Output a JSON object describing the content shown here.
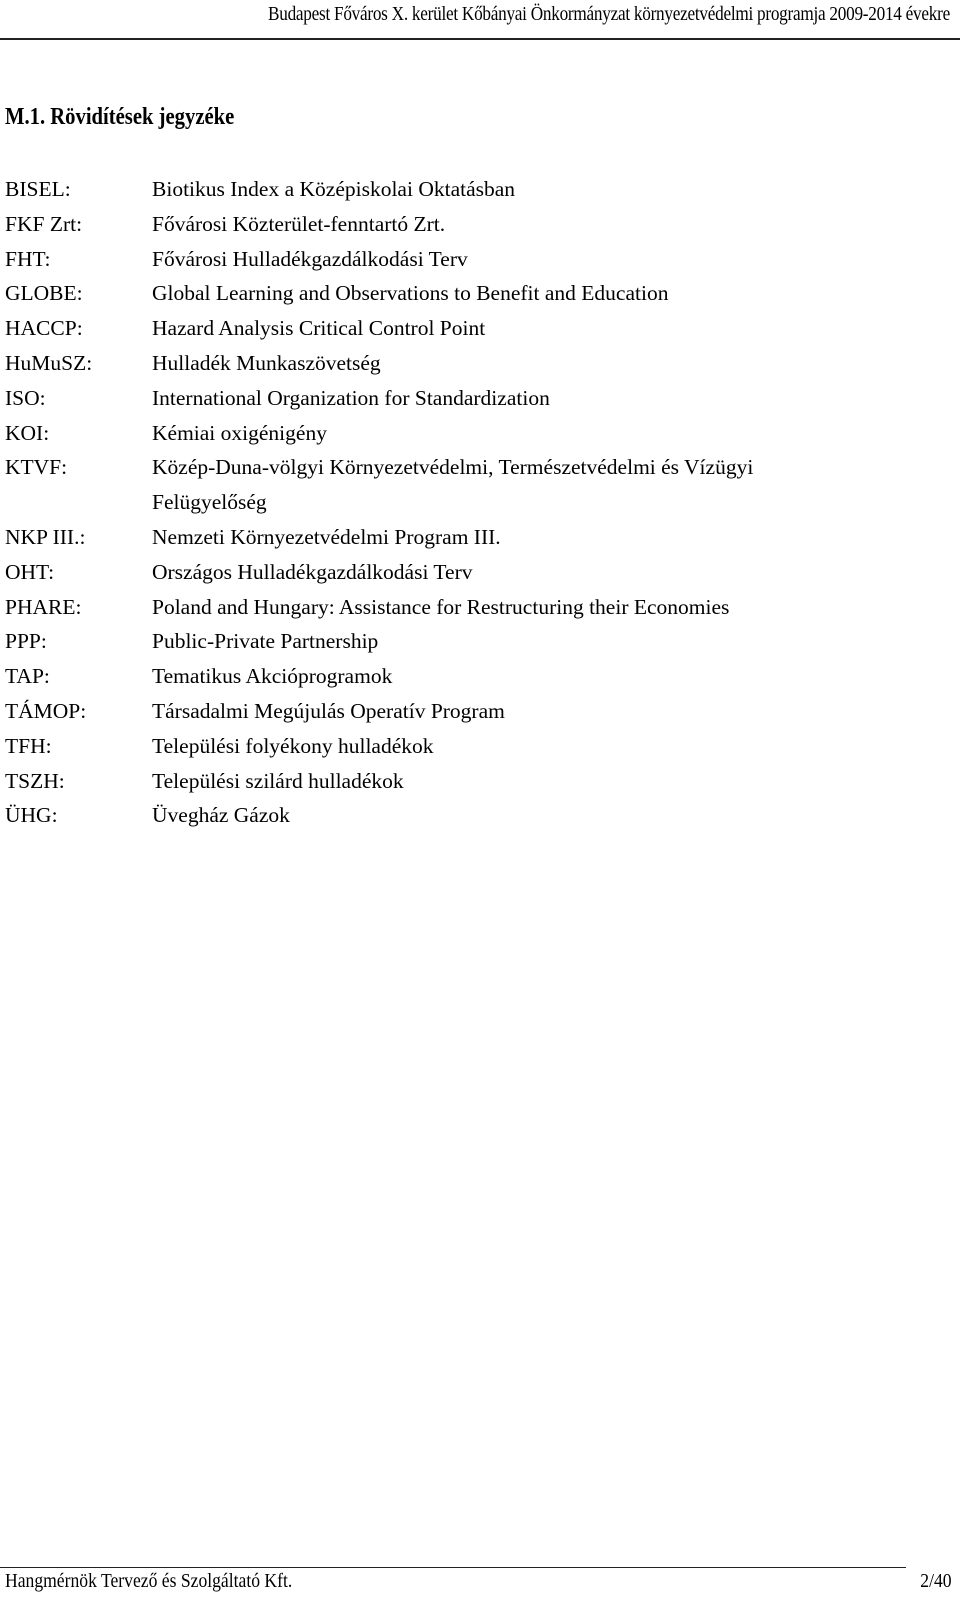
{
  "header": {
    "title": "Budapest Főváros X. kerület Kőbányai Önkormányzat környezetvédelmi programja 2009-2014 évekre"
  },
  "section": {
    "title": "M.1. Rövidítések jegyzéke"
  },
  "abbreviations": [
    {
      "term": "BISEL:",
      "definition": "Biotikus Index a Középiskolai Oktatásban"
    },
    {
      "term": "FKF Zrt:",
      "definition": "Fővárosi Közterület-fenntartó Zrt."
    },
    {
      "term": "FHT:",
      "definition": "Fővárosi Hulladékgazdálkodási Terv"
    },
    {
      "term": "GLOBE:",
      "definition": "Global Learning and Observations to Benefit and Education"
    },
    {
      "term": "HACCP:",
      "definition": "Hazard Analysis Critical Control Point"
    },
    {
      "term": "HuMuSZ:",
      "definition": "Hulladék Munkaszövetség"
    },
    {
      "term": "ISO:",
      "definition": "International Organization for Standardization"
    },
    {
      "term": "KOI:",
      "definition": "Kémiai oxigénigény"
    },
    {
      "term": "KTVF:",
      "definition": "Közép-Duna-völgyi Környezetvédelmi, Természetvédelmi és Vízügyi Felügyelőség"
    },
    {
      "term": "NKP III.:",
      "definition": "Nemzeti Környezetvédelmi Program III."
    },
    {
      "term": "OHT:",
      "definition": "Országos Hulladékgazdálkodási Terv"
    },
    {
      "term": "PHARE:",
      "definition": "Poland and Hungary: Assistance for Restructuring their Economies"
    },
    {
      "term": "PPP:",
      "definition": "Public-Private Partnership"
    },
    {
      "term": "TAP:",
      "definition": "Tematikus Akcióprogramok"
    },
    {
      "term": "TÁMOP:",
      "definition": "Társadalmi Megújulás Operatív Program"
    },
    {
      "term": "TFH:",
      "definition": "Települési folyékony hulladékok"
    },
    {
      "term": "TSZH:",
      "definition": "Települési szilárd hulladékok"
    },
    {
      "term": "ÜHG:",
      "definition": "Üvegház Gázok"
    }
  ],
  "footer": {
    "company": "Hangmérnök Tervező és Szolgáltató Kft.",
    "page": "2/40"
  }
}
